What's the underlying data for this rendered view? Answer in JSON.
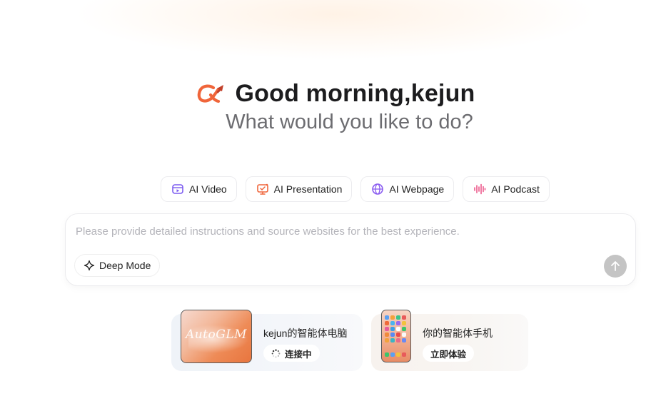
{
  "hero": {
    "greeting": "Good morning,kejun",
    "subtitle": "What would you like to do?"
  },
  "chips": [
    {
      "label": "AI Video",
      "icon": "video-icon",
      "color": "#7c5cf0"
    },
    {
      "label": "AI Presentation",
      "icon": "presentation-icon",
      "color": "#f0653a"
    },
    {
      "label": "AI Webpage",
      "icon": "globe-icon",
      "color": "#8a5cf0"
    },
    {
      "label": "AI Podcast",
      "icon": "audio-wave-icon",
      "color": "#ec5a8c"
    }
  ],
  "composer": {
    "placeholder": "Please provide detailed instructions and source websites for the best experience.",
    "value": "",
    "deep_mode_label": "Deep Mode"
  },
  "cards": {
    "pc": {
      "title": "kejun的智能体电脑",
      "status": "连接中",
      "thumb_text": "AutoGLM"
    },
    "phone": {
      "title": "你的智能体手机",
      "action": "立即体验"
    }
  },
  "colors": {
    "brand_orange": "#f0653a",
    "send_disabled": "#c4c4c4"
  }
}
